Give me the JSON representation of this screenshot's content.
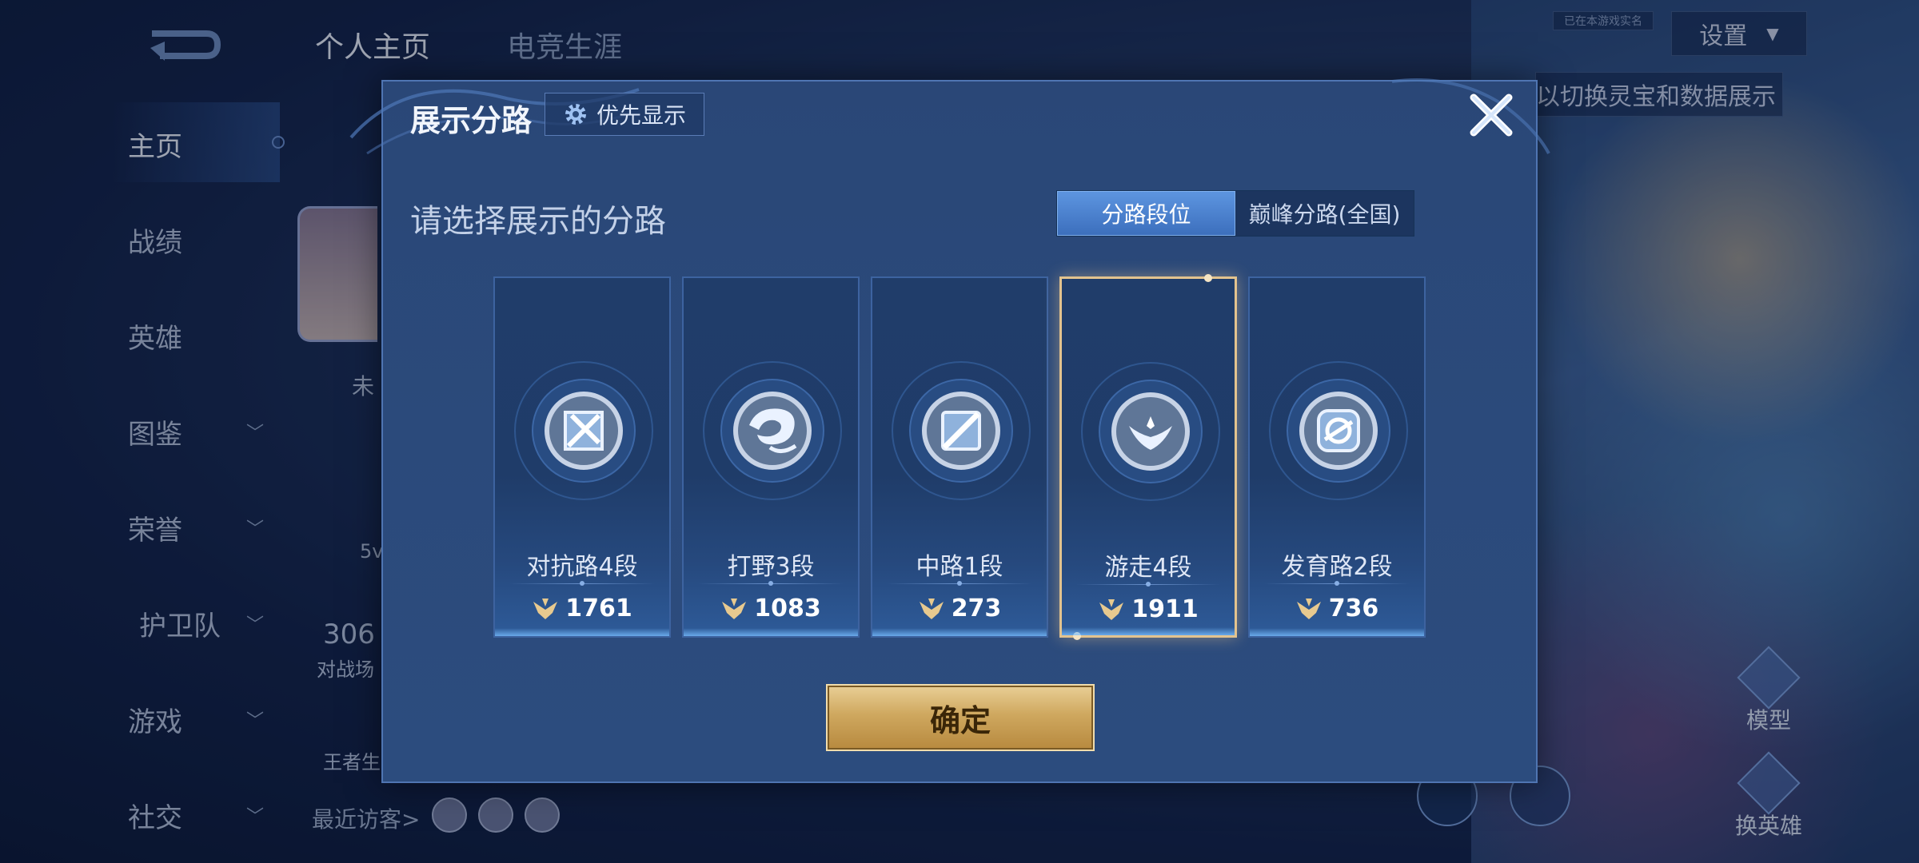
{
  "background": {
    "top_tabs": [
      "个人主页",
      "电竞生涯"
    ],
    "settings_label": "设置",
    "tiny_badge": "已在本游戏实名",
    "hint_text": "以切换灵宝和数据展示",
    "sidebar": [
      {
        "label": "主页",
        "active": true,
        "chevron": false
      },
      {
        "label": "战绩",
        "active": false,
        "chevron": false
      },
      {
        "label": "英雄",
        "active": false,
        "chevron": false
      },
      {
        "label": "图鉴",
        "active": false,
        "chevron": true
      },
      {
        "label": "荣誉",
        "active": false,
        "chevron": true
      },
      {
        "label": "护卫队",
        "active": false,
        "chevron": true
      },
      {
        "label": "游戏",
        "active": false,
        "chevron": true
      },
      {
        "label": "社交",
        "active": false,
        "chevron": true
      }
    ],
    "peek_texts": {
      "status": "未",
      "small": "5v",
      "count": "306",
      "battle_label": "对战场",
      "king_label": "王者生"
    },
    "visitors_label": "最近访客>",
    "right_buttons": {
      "model": "模型",
      "change_hero": "换英雄"
    }
  },
  "modal": {
    "title": "展示分路",
    "priority_button": "优先显示",
    "subtitle": "请选择展示的分路",
    "segments": [
      {
        "label": "分路段位",
        "selected": true
      },
      {
        "label": "巅峰分路(全国)",
        "selected": false
      }
    ],
    "cards": [
      {
        "rank": "对抗路4段",
        "score": "1761",
        "icon": "clash-lane-emblem-icon",
        "selected": false
      },
      {
        "rank": "打野3段",
        "score": "1083",
        "icon": "jungle-emblem-icon",
        "selected": false
      },
      {
        "rank": "中路1段",
        "score": "273",
        "icon": "mid-lane-emblem-icon",
        "selected": false
      },
      {
        "rank": "游走4段",
        "score": "1911",
        "icon": "roam-emblem-icon",
        "selected": true
      },
      {
        "rank": "发育路2段",
        "score": "736",
        "icon": "farm-lane-emblem-icon",
        "selected": false
      }
    ],
    "confirm_label": "确定"
  },
  "colors": {
    "accent_gold": "#cfa85f",
    "selected_border": "#e3c38e",
    "segment_on": "#4a82cf"
  }
}
